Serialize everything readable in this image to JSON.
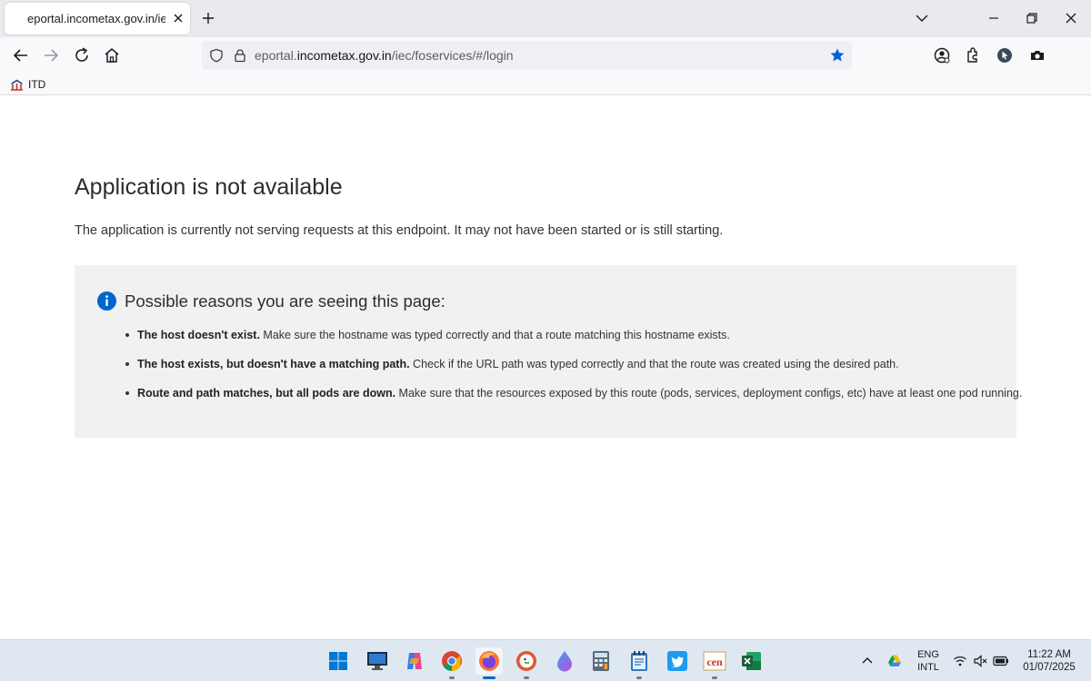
{
  "browser": {
    "tab": {
      "title": "eportal.incometax.gov.in/iec/foservices/#/login"
    },
    "url": {
      "prefix": "eportal.",
      "domain": "incometax.gov.in",
      "path": "/iec/foservices/#/login"
    },
    "bookmarks": [
      {
        "label": "ITD"
      }
    ]
  },
  "page": {
    "title": "Application is not available",
    "description": "The application is currently not serving requests at this endpoint. It may not have been started or is still starting.",
    "reasons_title": "Possible reasons you are seeing this page:",
    "reasons": [
      {
        "bold": "The host doesn't exist.",
        "text": " Make sure the hostname was typed correctly and that a route matching this hostname exists."
      },
      {
        "bold": "The host exists, but doesn't have a matching path.",
        "text": " Check if the URL path was typed correctly and that the route was created using the desired path."
      },
      {
        "bold": "Route and path matches, but all pods are down.",
        "text": " Make sure that the resources exposed by this route (pods, services, deployment configs, etc) have at least one pod running."
      }
    ]
  },
  "taskbar": {
    "apps": [
      "start-icon",
      "desktop-icon",
      "copilot-icon",
      "chrome-icon",
      "firefox-icon",
      "duckduckgo-icon",
      "drop-icon",
      "calculator-icon",
      "notepad-icon",
      "twitter-icon",
      "cen-app-icon",
      "excel-icon"
    ],
    "language": {
      "line1": "ENG",
      "line2": "INTL"
    },
    "time": "11:22 AM",
    "date": "01/07/2025"
  },
  "colors": {
    "accent": "#0060df",
    "info": "#0066cc",
    "star": "#0060df"
  }
}
